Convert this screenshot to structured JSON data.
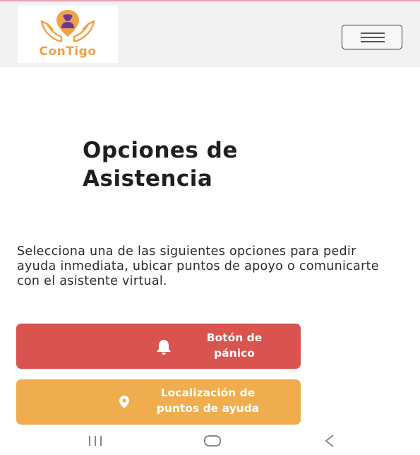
{
  "brand": {
    "name": "ConTigo",
    "color": "#f0a246"
  },
  "header": {
    "menu_icon": "hamburger-icon"
  },
  "main": {
    "title": "Opciones de Asistencia",
    "description": "Selecciona una de las siguientes opciones para pedir ayuda inmediata, ubicar puntos de apoyo o comunicarte con el asistente virtual."
  },
  "options": [
    {
      "label": "Botón de pánico",
      "icon": "bell-icon",
      "color": "#d9534f"
    },
    {
      "label": "Localización de puntos de ayuda",
      "icon": "map-pin-icon",
      "color": "#f0ad4e"
    }
  ],
  "android_nav": {
    "recents": "recents-icon",
    "home": "home-icon",
    "back": "back-icon"
  }
}
